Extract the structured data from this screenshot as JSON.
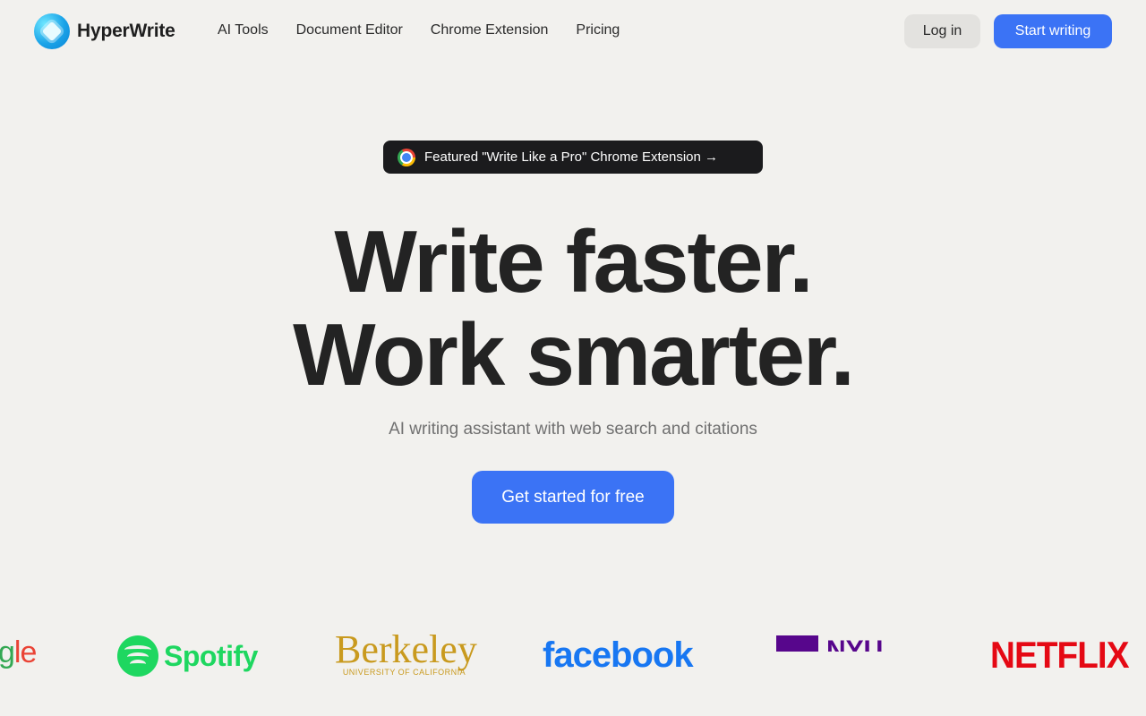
{
  "header": {
    "brand": "HyperWrite",
    "nav": [
      "AI Tools",
      "Document Editor",
      "Chrome Extension",
      "Pricing"
    ],
    "login_label": "Log in",
    "start_label": "Start writing"
  },
  "featured": {
    "text": "Featured \"Write Like a Pro\" Chrome Extension →",
    "icon": "chrome-icon"
  },
  "hero": {
    "line1": "Write faster.",
    "line2": "Work smarter.",
    "subtitle": "AI writing assistant with web search and citations",
    "cta_label": "Get started for free"
  },
  "logos": {
    "google_fragment_a": "g",
    "google_fragment_b": "le",
    "spotify": "Spotify",
    "berkeley": "Berkeley",
    "berkeley_sub": "UNIVERSITY OF CALIFORNIA",
    "facebook": "facebook",
    "nyu": "NYU",
    "netflix": "NETFLIX"
  },
  "colors": {
    "accent": "#3b73f5",
    "background": "#f2f1ee",
    "pill_bg": "#1b1b1d"
  }
}
